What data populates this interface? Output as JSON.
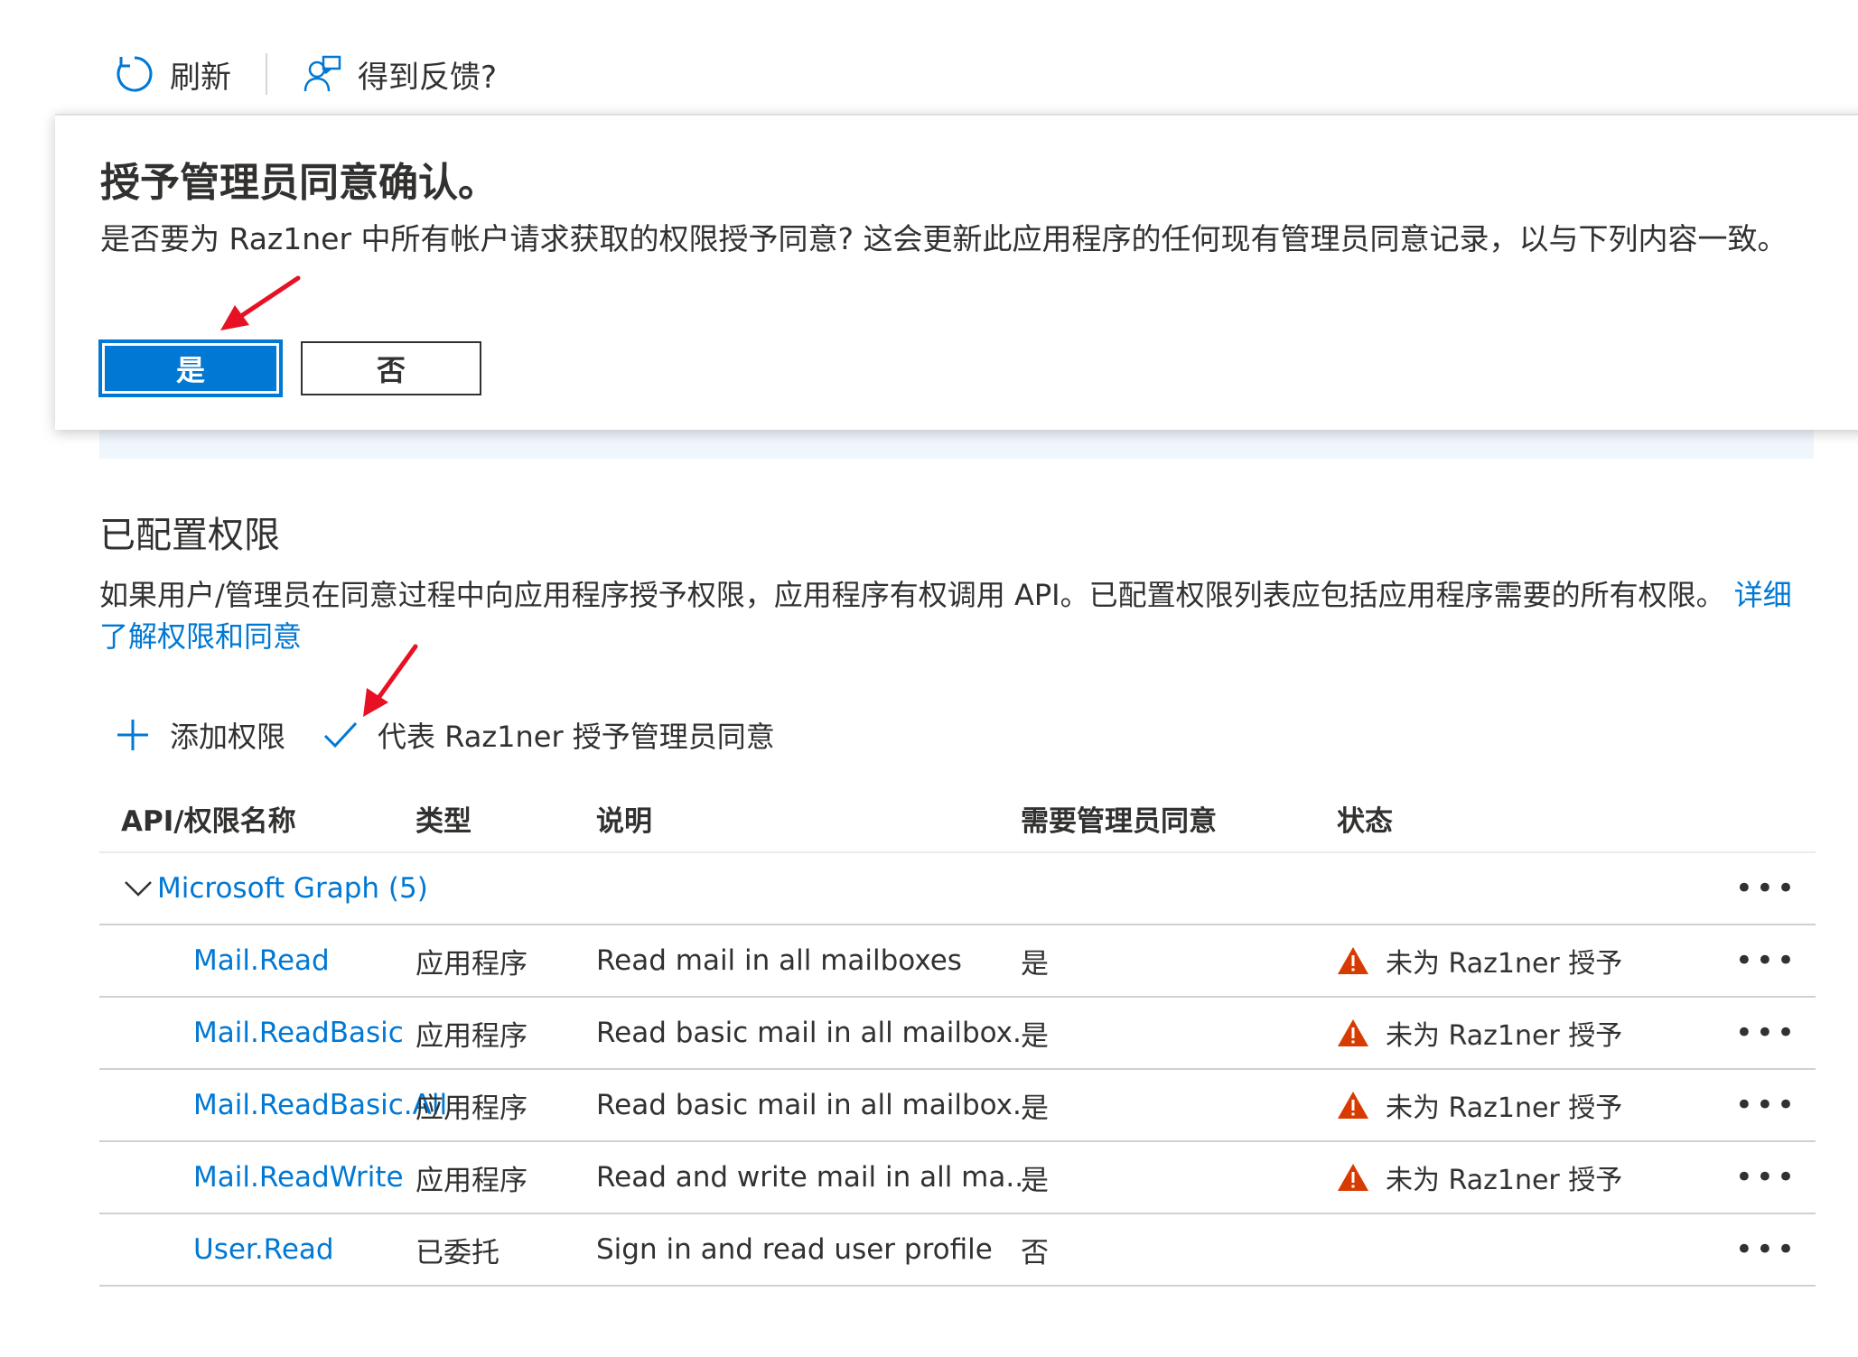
{
  "toolbar": {
    "refresh_label": "刷新",
    "feedback_label": "得到反馈?"
  },
  "dialog": {
    "title": "授予管理员同意确认。",
    "message": "是否要为 Raz1ner 中所有帐户请求获取的权限授予同意? 这会更新此应用程序的任何现有管理员同意记录，以与下列内容一致。",
    "yes_label": "是",
    "no_label": "否"
  },
  "permissions": {
    "title": "已配置权限",
    "description": "如果用户/管理员在同意过程中向应用程序授予权限，应用程序有权调用 API。已配置权限列表应包括应用程序需要的所有权限。",
    "learn_more_link": "详细了解权限和同意",
    "add_permission_label": "添加权限",
    "grant_consent_label": "代表 Raz1ner 授予管理员同意"
  },
  "table": {
    "headers": [
      "API/权限名称",
      "类型",
      "说明",
      "需要管理员同意",
      "状态"
    ],
    "group_label": "Microsoft Graph (5)",
    "more_label": "•••",
    "rows": [
      {
        "name": "Mail.Read",
        "type": "应用程序",
        "desc": "Read mail in all mailboxes",
        "admin": "是",
        "status": "未为 Raz1ner 授予"
      },
      {
        "name": "Mail.ReadBasic",
        "type": "应用程序",
        "desc": "Read basic mail in all mailbox...",
        "admin": "是",
        "status": "未为 Raz1ner 授予"
      },
      {
        "name": "Mail.ReadBasic.All",
        "type": "应用程序",
        "desc": "Read basic mail in all mailbox...",
        "admin": "是",
        "status": "未为 Raz1ner 授予"
      },
      {
        "name": "Mail.ReadWrite",
        "type": "应用程序",
        "desc": "Read and write mail in all ma...",
        "admin": "是",
        "status": "未为 Raz1ner 授予"
      },
      {
        "name": "User.Read",
        "type": "已委托",
        "desc": "Sign in and read user profile",
        "admin": "否",
        "status": ""
      }
    ]
  },
  "colors": {
    "accent": "#0078d4",
    "warning": "#d83b01",
    "annotation_arrow": "#e81123"
  }
}
